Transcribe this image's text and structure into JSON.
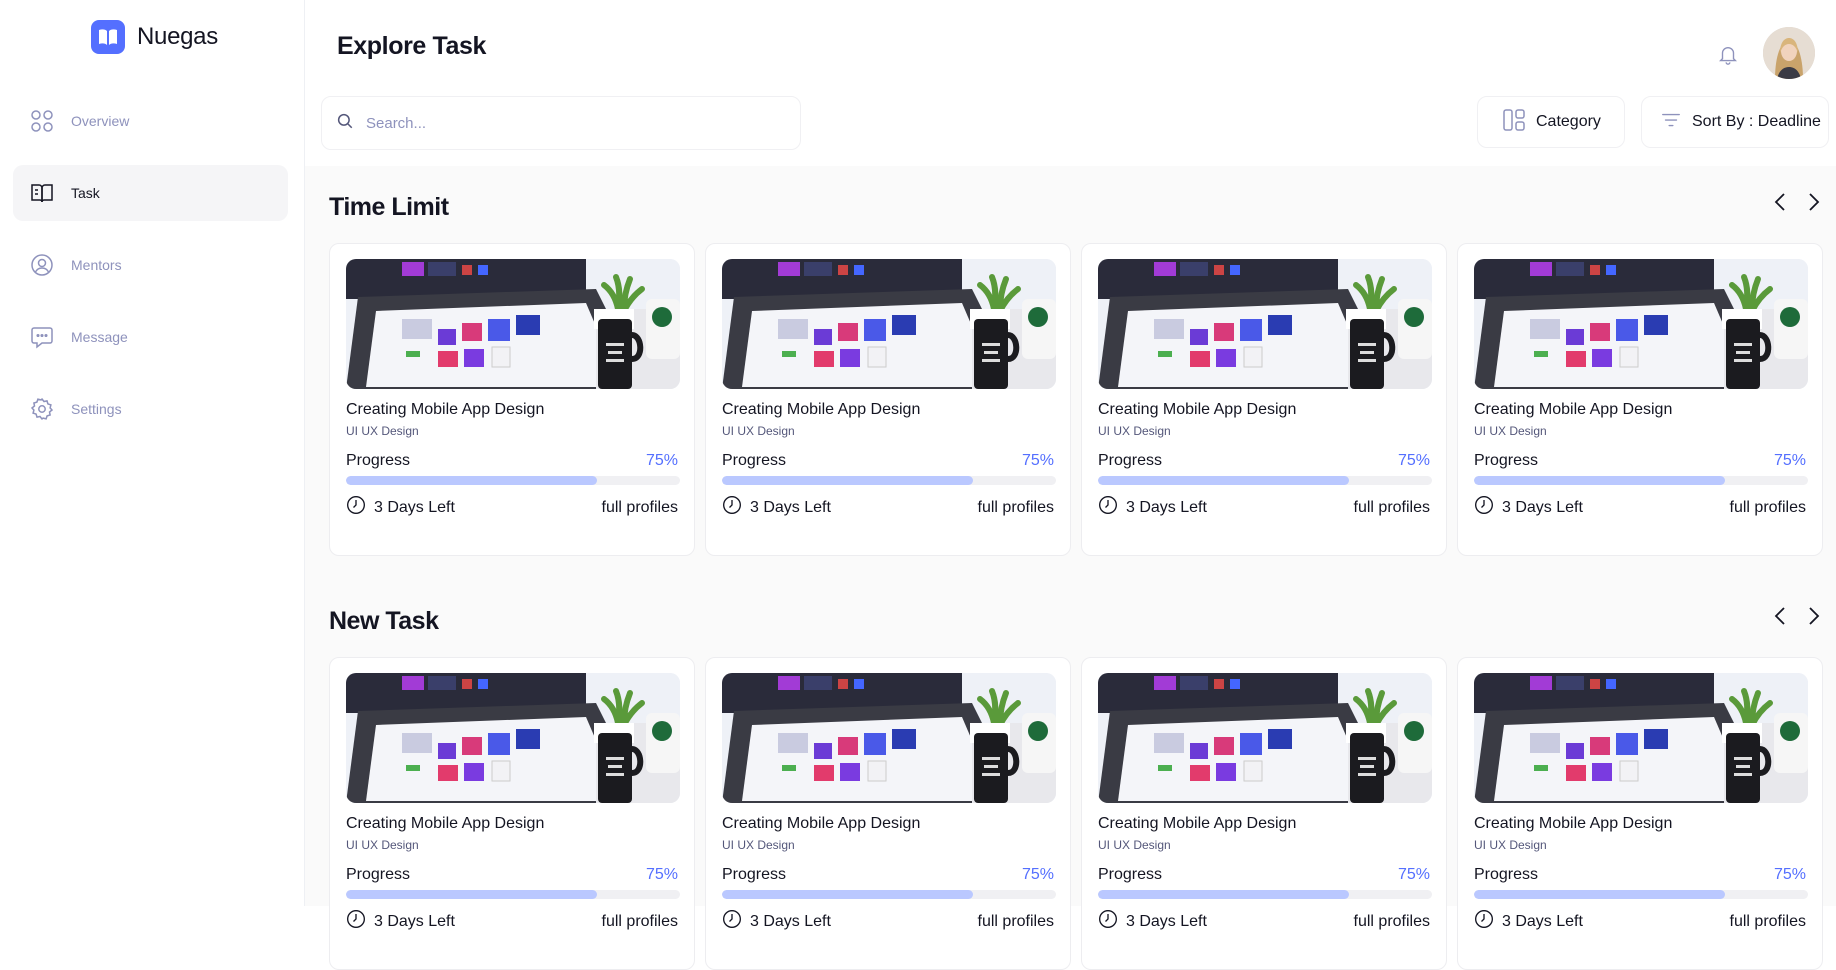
{
  "brand": {
    "name": "Nuegas",
    "accent": "#546FFF"
  },
  "sidebar": {
    "items": [
      {
        "label": "Overview",
        "icon": "grid-icon",
        "active": false
      },
      {
        "label": "Task",
        "icon": "book-icon",
        "active": true
      },
      {
        "label": "Mentors",
        "icon": "user-icon",
        "active": false
      },
      {
        "label": "Message",
        "icon": "chat-icon",
        "active": false
      },
      {
        "label": "Settings",
        "icon": "gear-icon",
        "active": false
      }
    ]
  },
  "header": {
    "title": "Explore Task"
  },
  "search": {
    "placeholder": "Search..."
  },
  "filters": {
    "category_label": "Category",
    "sort_label": "Sort By : Deadline"
  },
  "sections": [
    {
      "title": "Time Limit",
      "cards": [
        {
          "title": "Creating Mobile App Design",
          "subtitle": "UI UX Design",
          "progress_label": "Progress",
          "progress_text": "75%",
          "progress": 0.75,
          "days_left": "3 Days Left",
          "profiles": "full profiles"
        },
        {
          "title": "Creating Mobile App Design",
          "subtitle": "UI UX Design",
          "progress_label": "Progress",
          "progress_text": "75%",
          "progress": 0.75,
          "days_left": "3 Days Left",
          "profiles": "full profiles"
        },
        {
          "title": "Creating Mobile App Design",
          "subtitle": "UI UX Design",
          "progress_label": "Progress",
          "progress_text": "75%",
          "progress": 0.75,
          "days_left": "3 Days Left",
          "profiles": "full profiles"
        },
        {
          "title": "Creating Mobile App Design",
          "subtitle": "UI UX Design",
          "progress_label": "Progress",
          "progress_text": "75%",
          "progress": 0.75,
          "days_left": "3 Days Left",
          "profiles": "full profiles"
        }
      ]
    },
    {
      "title": "New Task",
      "cards": [
        {
          "title": "Creating Mobile App Design",
          "subtitle": "UI UX Design",
          "progress_label": "Progress",
          "progress_text": "75%",
          "progress": 0.75,
          "days_left": "3 Days Left",
          "profiles": "full profiles"
        },
        {
          "title": "Creating Mobile App Design",
          "subtitle": "UI UX Design",
          "progress_label": "Progress",
          "progress_text": "75%",
          "progress": 0.75,
          "days_left": "3 Days Left",
          "profiles": "full profiles"
        },
        {
          "title": "Creating Mobile App Design",
          "subtitle": "UI UX Design",
          "progress_label": "Progress",
          "progress_text": "75%",
          "progress": 0.75,
          "days_left": "3 Days Left",
          "profiles": "full profiles"
        },
        {
          "title": "Creating Mobile App Design",
          "subtitle": "UI UX Design",
          "progress_label": "Progress",
          "progress_text": "75%",
          "progress": 0.75,
          "days_left": "3 Days Left",
          "profiles": "full profiles"
        }
      ]
    }
  ]
}
